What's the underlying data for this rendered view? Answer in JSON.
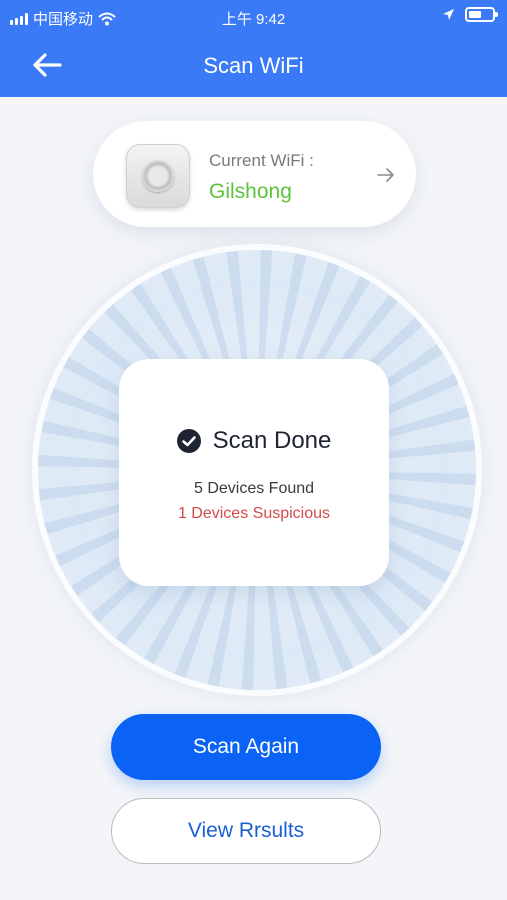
{
  "status_bar": {
    "carrier": "中国移动",
    "time": "上午 9:42"
  },
  "header": {
    "title": "Scan WiFi"
  },
  "wifi": {
    "caption": "Current WiFi :",
    "name": "Gilshong",
    "name_color": "#5cc33b"
  },
  "result": {
    "status": "Scan Done",
    "devices_found": "5 Devices Found",
    "suspicious": "1 Devices Suspicious",
    "suspicious_color": "#d54b4b"
  },
  "actions": {
    "scan_again": "Scan Again",
    "view_results": "View Rrsults"
  },
  "colors": {
    "header": "#3a7af6",
    "primary": "#0a63f5"
  },
  "icons": [
    "signal-icon",
    "wifi-icon",
    "location-icon",
    "battery-icon",
    "back-arrow-icon",
    "router-icon",
    "arrow-right-icon",
    "check-circle-icon"
  ]
}
